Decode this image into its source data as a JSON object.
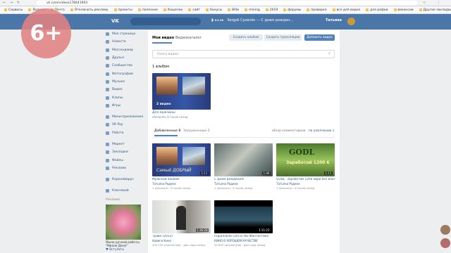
{
  "browser": {
    "url": "vk.com/videos178441903",
    "bookmarks": [
      "Сервисы",
      "Яндекс",
      "Почта",
      "Отключить рекламу",
      "проекты",
      "полезное",
      "Кошелек",
      "сайт",
      "бонусы",
      "Blite",
      "mining",
      "2019",
      "форумы",
      "проверка",
      "все для видео",
      "для рефки",
      "вакансии",
      "Другие закладки"
    ]
  },
  "badge": {
    "text": "6+"
  },
  "header": {
    "logo": "vk-logo",
    "player_text": "Sergeii Cysenko — С днем рожден...",
    "user_name": "Татьяна"
  },
  "sidebar": {
    "items": [
      "Моя страница",
      "Новости",
      "Мессенджер",
      "Друзья",
      "Сообщества",
      "Фотографии",
      "Музыка",
      "Видео",
      "Клипы",
      "Игры"
    ],
    "items2": [
      "Мини-приложения",
      "VK Pay",
      "Работа"
    ],
    "items3": [
      "Маркет",
      "Закладки",
      "Файлы",
      "Реклама"
    ],
    "items4": [
      "Коронавирус"
    ],
    "items5": [
      "Ключевой"
    ],
    "ads_label": "Реклама",
    "ad_caption": "Мыло ручной работы \"Милое Дело\"",
    "ad_sub": "♥ Вступить"
  },
  "main": {
    "tabs": [
      "Мои видео",
      "Видеокаталог"
    ],
    "buttons": {
      "album": "Создать альбом",
      "stream": "Создать трансляцию",
      "add": "Добавить видео"
    },
    "search_placeholder": "Поиск видео",
    "albums_count": "1 альбом",
    "album": {
      "name": "Для мужчины",
      "sub": "обновлён 8 часов назад",
      "count": "2 видео"
    },
    "subtabs": {
      "added": "Добавленные 8",
      "uploaded": "Загруженные 2"
    },
    "sort_label": "обзор комментариев",
    "sort_value": "по умолчанию ∨",
    "videos": [
      {
        "title": "Мужской альбом",
        "author": "Татьяна Родина",
        "meta": "1 просмотр · 8 часов назад",
        "duration": "1:11"
      },
      {
        "title": "С Днем рождения!",
        "author": "Татьяна Родина",
        "meta": "1 просмотр · 8 часов назад",
        "duration": "1:46"
      },
      {
        "title": "GODL. Заработай 1200 евро без вложени...",
        "author": "Татьяна Родина",
        "meta": "1 просмотр · 8 часов назад",
        "duration": "1:11"
      },
      {
        "title": "Травн (2013)",
        "author": "Навиги Кино",
        "meta": "434 155 просмотров · два года назад",
        "duration": "1:36:28"
      },
      {
        "title": "Параллели (2013) HD Фантастика",
        "author": "КИНО В ХОРОШЕМ КАЧЕСТВЕ",
        "meta": "39 655 просмотров · два года назад",
        "duration": "1:11:23"
      }
    ],
    "fancy_text": "Самый ДОБРЫЙ",
    "godl_text": "GODL",
    "godl_sub": "Заработай 1200 €"
  },
  "colors": {
    "vk_blue": "#4a76a8",
    "button_blue": "#5181b8",
    "link": "#2a5885"
  }
}
